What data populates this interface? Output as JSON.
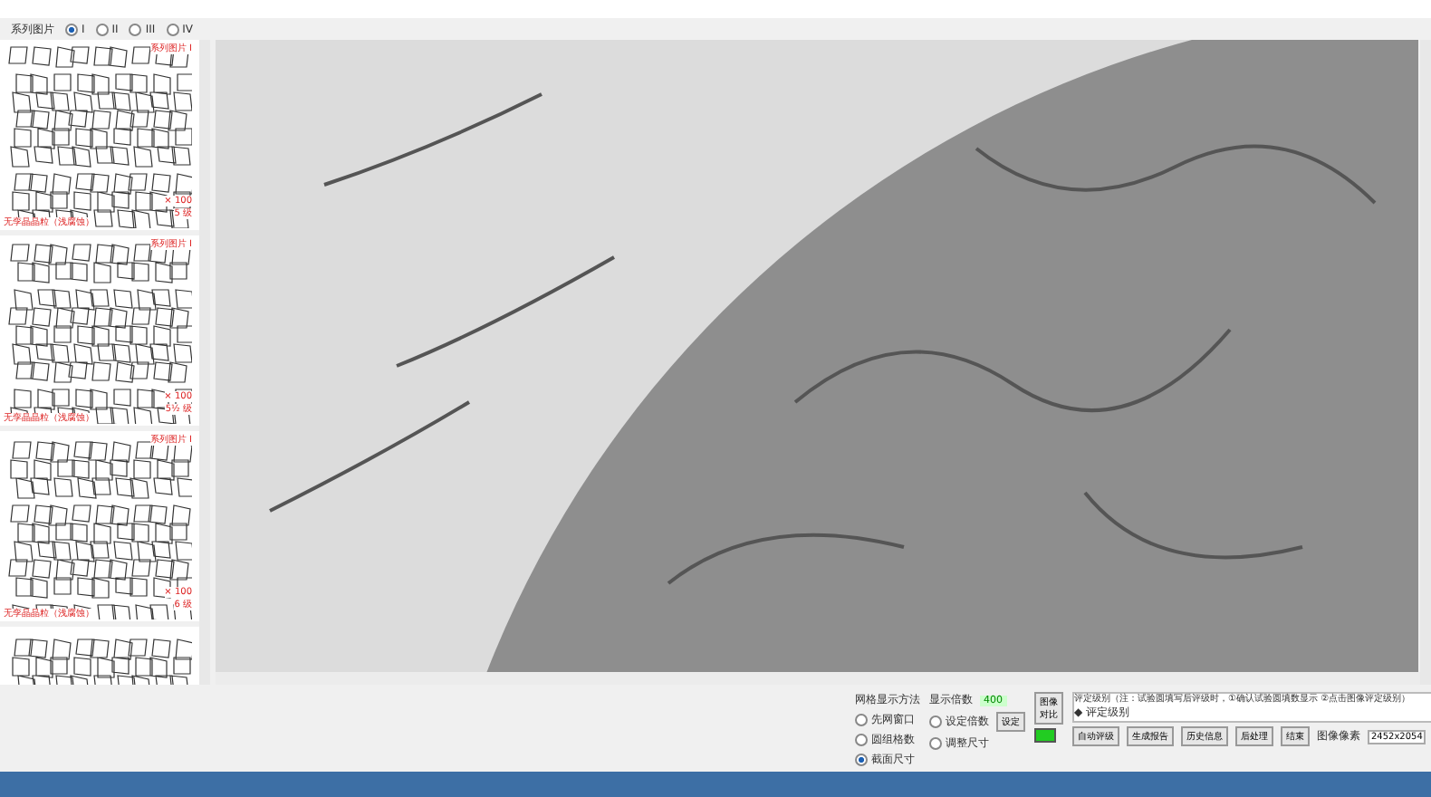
{
  "series_bar": {
    "label": "系列图片",
    "options": [
      {
        "label": "I",
        "selected": true
      },
      {
        "label": "II",
        "selected": false
      },
      {
        "label": "III",
        "selected": false
      },
      {
        "label": "IV",
        "selected": false
      }
    ]
  },
  "thumbnails": [
    {
      "series": "系列图片 I",
      "magnification": "× 100",
      "grade": "5 级",
      "caption": "无孪晶晶粒（浅腐蚀）"
    },
    {
      "series": "系列图片 I",
      "magnification": "× 100",
      "grade": "5½ 级",
      "caption": "无孪晶晶粒（浅腐蚀）"
    },
    {
      "series": "系列图片 I",
      "magnification": "× 100",
      "grade": "6 级",
      "caption": "无孪晶晶粒（浅腐蚀）"
    }
  ],
  "grid_method": {
    "title": "网格显示方法",
    "options": [
      {
        "label": "先网窗口",
        "selected": false
      },
      {
        "label": "圆组格数",
        "selected": false
      },
      {
        "label": "截面尺寸",
        "selected": true
      }
    ]
  },
  "magnification": {
    "label": "显示倍数",
    "value": "400",
    "options": [
      {
        "label": "设定倍数",
        "selected": false
      },
      {
        "label": "调整尺寸",
        "selected": false
      }
    ],
    "set_button": "设定"
  },
  "compare_button": "图像对比",
  "rating": {
    "note": "评定级别（注：试验圆填写后评级时，①确认试验圆填数显示 ②点击图像评定级别）",
    "value": "◆ 评定级别"
  },
  "buttons": [
    "自动评级",
    "生成报告",
    "历史信息"
  ],
  "right_buttons": [
    "后处理",
    "结束"
  ],
  "pixels": {
    "label": "图像像素",
    "value": "2452x2054"
  }
}
